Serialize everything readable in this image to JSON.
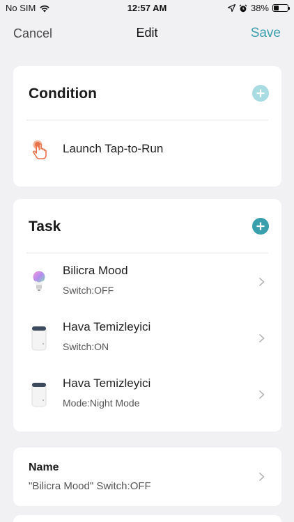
{
  "status": {
    "carrier": "No SIM",
    "time": "12:57 AM",
    "battery": "38%",
    "battery_level": 0.38
  },
  "nav": {
    "cancel": "Cancel",
    "title": "Edit",
    "save": "Save"
  },
  "condition": {
    "title": "Condition",
    "item": {
      "label": "Launch Tap-to-Run",
      "icon": "tap-hand-icon"
    }
  },
  "task": {
    "title": "Task",
    "items": [
      {
        "title": "Bilicra Mood",
        "subtitle": "Switch:OFF",
        "icon": "smart-bulb-icon"
      },
      {
        "title": "Hava Temizleyici",
        "subtitle": "Switch:ON",
        "icon": "air-purifier-icon"
      },
      {
        "title": "Hava Temizleyici",
        "subtitle": "Mode:Night Mode",
        "icon": "air-purifier-icon"
      }
    ]
  },
  "name": {
    "label": "Name",
    "value": "\"Bilicra Mood\" Switch:OFF"
  },
  "colors": {
    "accent": "#3a9fad",
    "accent_light": "#a9dbe2",
    "background": "#f1f1f3",
    "tap_icon": "#e8734a"
  }
}
